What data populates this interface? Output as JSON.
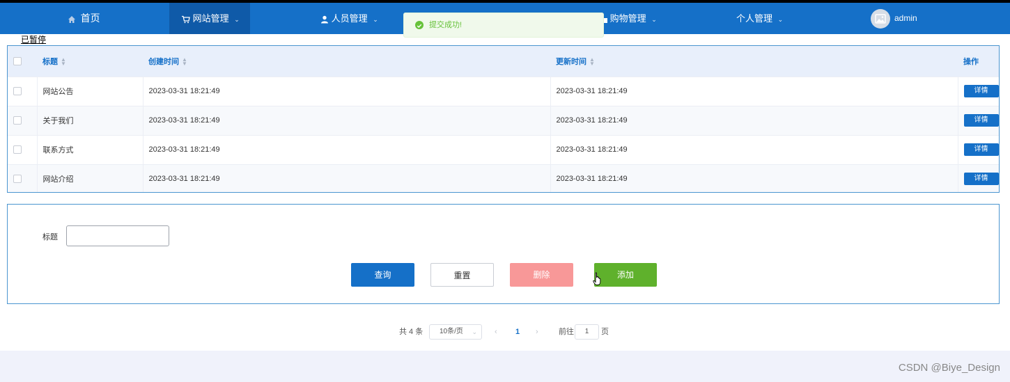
{
  "nav": {
    "items": [
      {
        "label": "首页",
        "icon": "home-icon"
      },
      {
        "label": "网站管理",
        "icon": "cart-icon",
        "active": true
      },
      {
        "label": "人员管理",
        "icon": "user-icon"
      },
      {
        "label": "购物管理",
        "icon": "shopping-bag-icon"
      },
      {
        "label": "个人管理",
        "icon": ""
      }
    ],
    "user": "admin"
  },
  "toast": {
    "message": "提交成功!",
    "type": "success"
  },
  "status_text": "已暂停",
  "table": {
    "columns": [
      "标题",
      "创建时间",
      "更新时间",
      "操作"
    ],
    "rows": [
      {
        "title": "网站公告",
        "created": "2023-03-31 18:21:49",
        "updated": "2023-03-31 18:21:49",
        "action": "详情"
      },
      {
        "title": "关于我们",
        "created": "2023-03-31 18:21:49",
        "updated": "2023-03-31 18:21:49",
        "action": "详情"
      },
      {
        "title": "联系方式",
        "created": "2023-03-31 18:21:49",
        "updated": "2023-03-31 18:21:49",
        "action": "详情"
      },
      {
        "title": "网站介绍",
        "created": "2023-03-31 18:21:49",
        "updated": "2023-03-31 18:21:49",
        "action": "详情"
      }
    ]
  },
  "search": {
    "title_label": "标题",
    "title_value": "",
    "query_label": "查询",
    "reset_label": "重置",
    "delete_label": "删除",
    "add_label": "添加"
  },
  "pagination": {
    "total_text": "共 4 条",
    "page_size": "10条/页",
    "current_page": "1",
    "goto_label": "前往",
    "goto_value": "1",
    "page_suffix": "页"
  },
  "watermark": "CSDN @Biye_Design",
  "colors": {
    "primary": "#1570c8",
    "success": "#67c23a",
    "danger": "#f89898",
    "add": "#5fb12c"
  }
}
